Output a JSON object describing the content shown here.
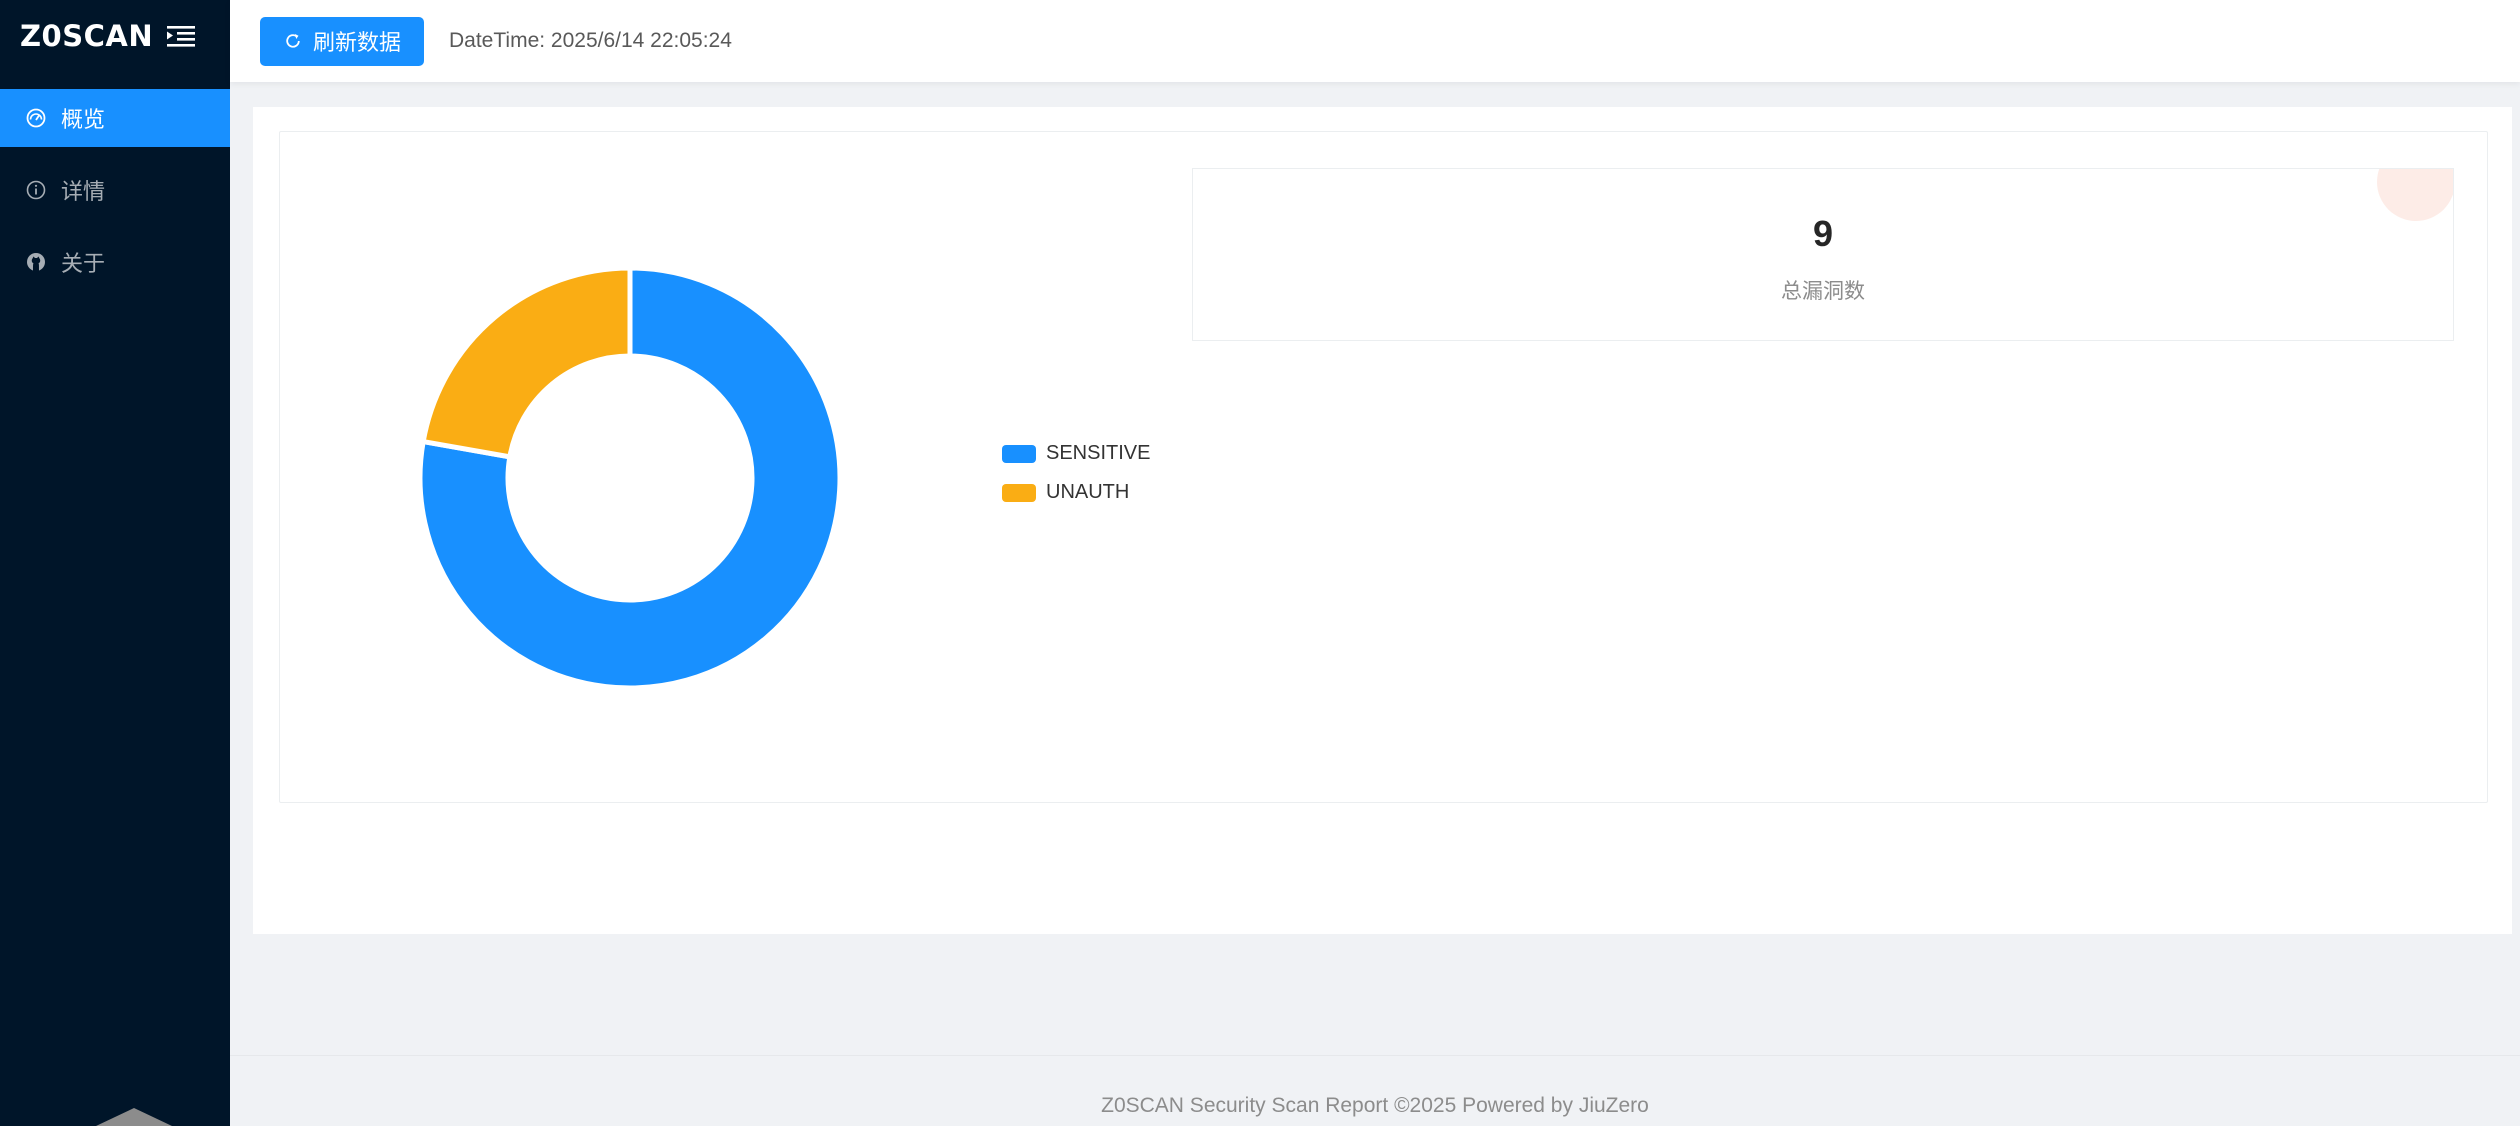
{
  "app": {
    "logo": "Z0SCAN"
  },
  "sidebar": {
    "items": [
      {
        "label": "概览",
        "icon": "dashboard-icon",
        "active": true
      },
      {
        "label": "详情",
        "icon": "info-circle-icon",
        "active": false
      },
      {
        "label": "关于",
        "icon": "github-icon",
        "active": false
      }
    ]
  },
  "header": {
    "refresh_label": "刷新数据",
    "datetime": "DateTime: 2025/6/14 22:05:24"
  },
  "stats": {
    "total_value": "9",
    "total_label": "总漏洞数"
  },
  "chart_data": {
    "type": "pie",
    "variant": "donut",
    "series": [
      {
        "name": "SENSITIVE",
        "value": 7,
        "color": "#1890ff"
      },
      {
        "name": "UNAUTH",
        "value": 2,
        "color": "#faad14"
      }
    ],
    "legend_position": "right"
  },
  "footer": {
    "text": "Z0SCAN Security Scan Report ©2025 Powered by JiuZero"
  },
  "colors": {
    "primary": "#1890ff",
    "sidebar_bg": "#001529",
    "warning": "#faad14"
  }
}
